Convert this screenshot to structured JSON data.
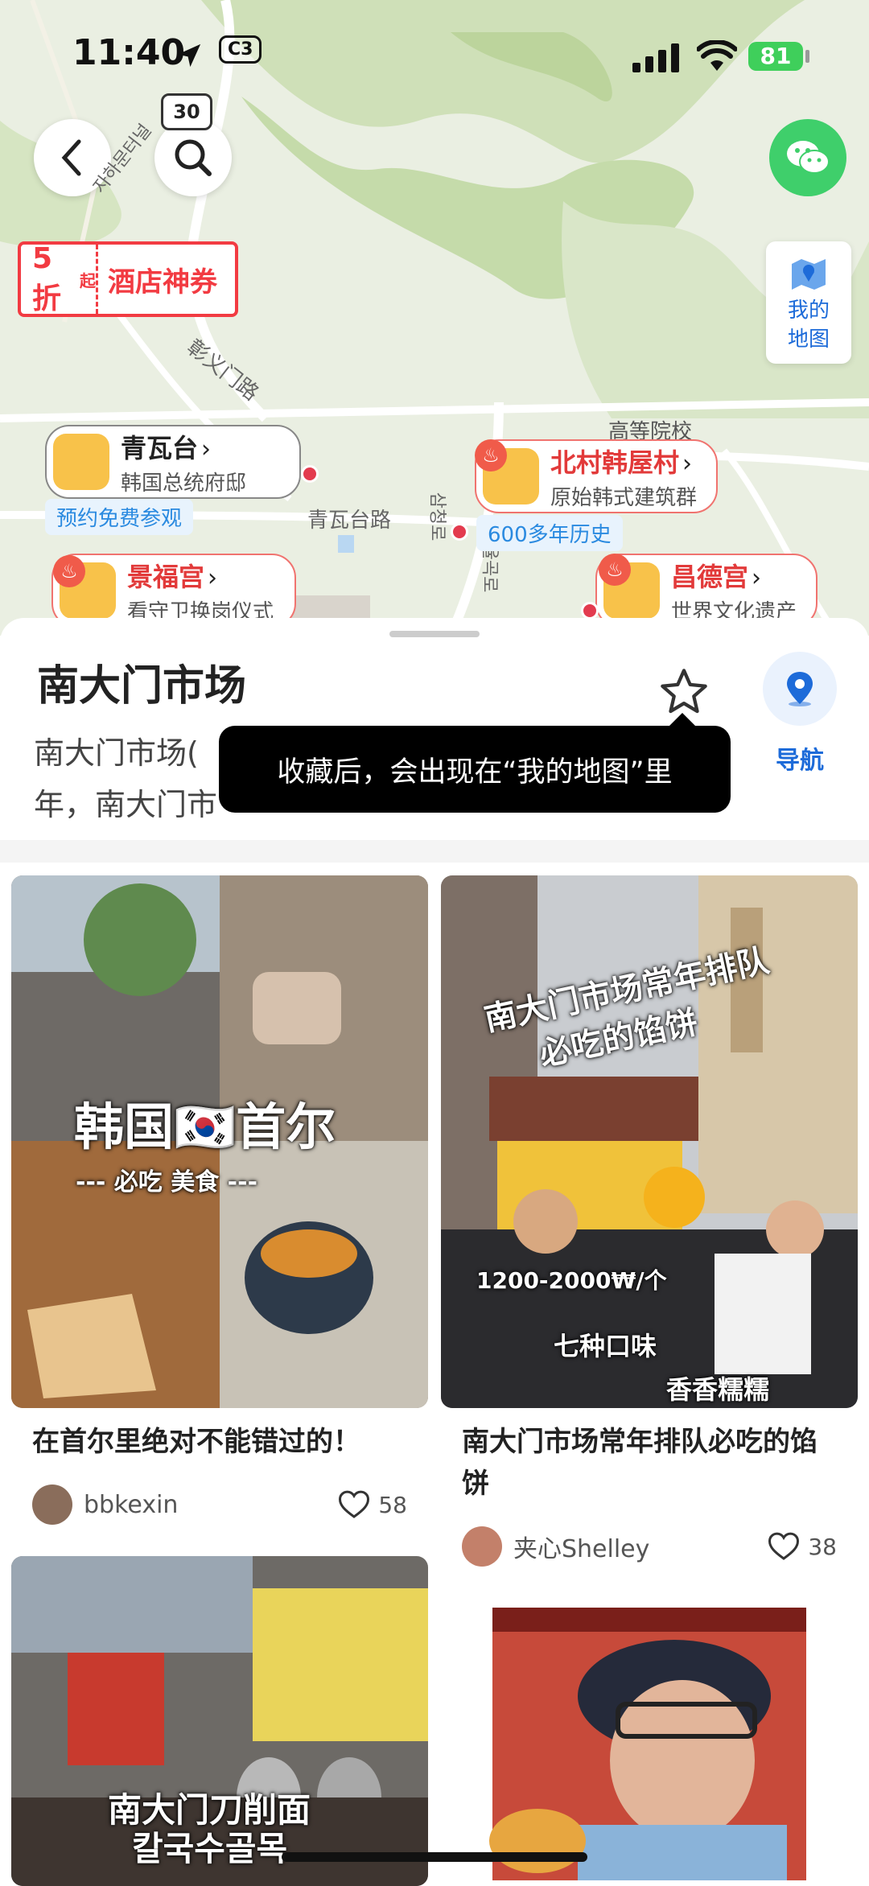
{
  "status": {
    "time": "11:40",
    "carrier": "C3",
    "battery": "81"
  },
  "map": {
    "search_badge": "30",
    "coupon": {
      "discount": "5折",
      "suffix": "起",
      "text": "酒店神券"
    },
    "my_map": {
      "line1": "我的",
      "line2": "地图"
    },
    "pois": [
      {
        "name": "青瓦台",
        "desc": "韩国总统府邸",
        "tag": "预约免费参观"
      },
      {
        "name": "北村韩屋村",
        "desc": "原始韩式建筑群",
        "tag": "600多年历史"
      },
      {
        "name": "景福宫",
        "desc": "看守卫换岗仪式"
      },
      {
        "name": "昌德宫",
        "desc": "世界文化遗产"
      }
    ],
    "labels": {
      "road1": "彰义门路",
      "road2": "青瓦台路",
      "school": "高等院校",
      "korean1": "삼청로",
      "korean2": "자하문터널",
      "korean3": "율곡로"
    }
  },
  "sheet": {
    "title": "南大门市场",
    "desc_line1": "南大门市场(",
    "desc_line2": "年，南大门市",
    "tooltip": "收藏后，会出现在“我的地图”里",
    "nav_label": "导航"
  },
  "feed": [
    {
      "title": "在首尔里绝对不能错过的！",
      "author": "bbkexin",
      "likes": "58",
      "overlay": {
        "main": "韩国🇰🇷首尔",
        "sub": "--- 必吃 美食 ---"
      }
    },
    {
      "title": "南大门市场常年排队必吃的馅饼",
      "author": "夹心Shelley",
      "likes": "38",
      "overlay": {
        "main": "南大门市场常年排队",
        "main2": "必吃的馅饼",
        "price": "1200-2000₩/个",
        "flavor": "七种口味",
        "taste": "香香糯糯"
      }
    },
    {
      "overlay": {
        "main": "南大门刀削面",
        "sub": "칼국수골목"
      }
    }
  ],
  "colors": {
    "accent_blue": "#1d6bd9",
    "poi_red": "#e23a3a",
    "coupon_red": "#f23b42",
    "wechat_green": "#3fcf6b"
  }
}
